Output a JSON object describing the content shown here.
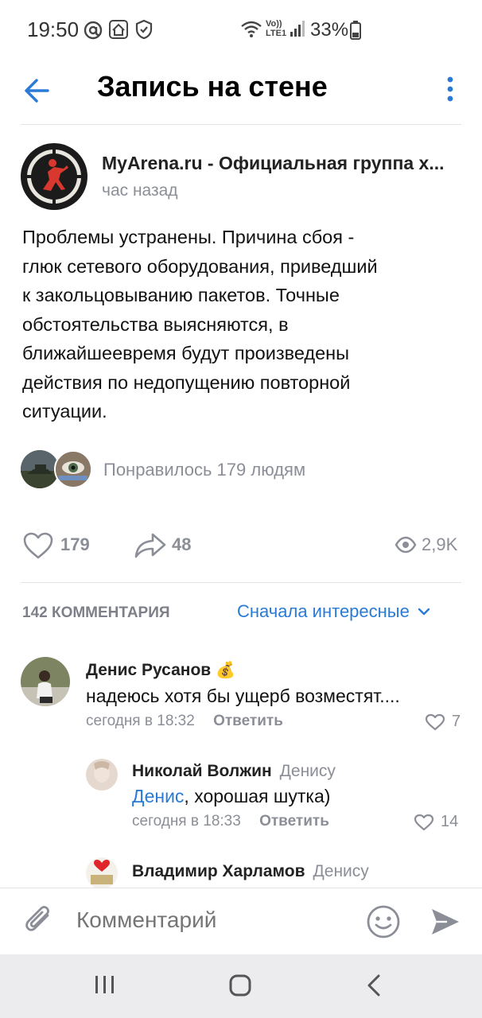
{
  "status_bar": {
    "time": "19:50",
    "battery": "33%",
    "network": "LTE1"
  },
  "header": {
    "title": "Запись на стене",
    "back_icon": "arrow-left-icon",
    "more_icon": "more-vertical-icon"
  },
  "post": {
    "author": "MyArena.ru - Официальная группа х...",
    "time": "час назад",
    "text_lines": [
      "Проблемы устранены. Причина сбоя -",
      "глюк сетевого оборудования, приведший",
      "к закольцовыванию пакетов. Точные",
      "обстоятельства выясняются, в",
      "ближайшеевремя будут произведены",
      "действия по недопущению повторной",
      "ситуации."
    ],
    "liked_by_text": "Понравилось 179 людям",
    "likes": "179",
    "shares": "48",
    "views": "2,9K"
  },
  "comments_header": {
    "count_label": "142 КОММЕНТАРИЯ",
    "sort_label": "Сначала интересные"
  },
  "comments": [
    {
      "author": "Денис Русанов",
      "badge": "💰",
      "text": "надеюсь хотя бы ущерб возместят....",
      "time": "сегодня в 18:32",
      "reply_label": "Ответить",
      "likes": "7"
    },
    {
      "author": "Николай Волжин",
      "reply_to": "Денису",
      "mention": "Денис",
      "text": ", хорошая шутка)",
      "time": "сегодня в 18:33",
      "reply_label": "Ответить",
      "likes": "14"
    },
    {
      "author": "Владимир Харламов",
      "reply_to": "Денису"
    }
  ],
  "composer": {
    "placeholder": "Комментарий"
  },
  "colors": {
    "accent": "#2a7bd5",
    "secondary_text": "#8b8e96",
    "divider": "#e3e4e8",
    "navbar_bg": "#ececee"
  }
}
